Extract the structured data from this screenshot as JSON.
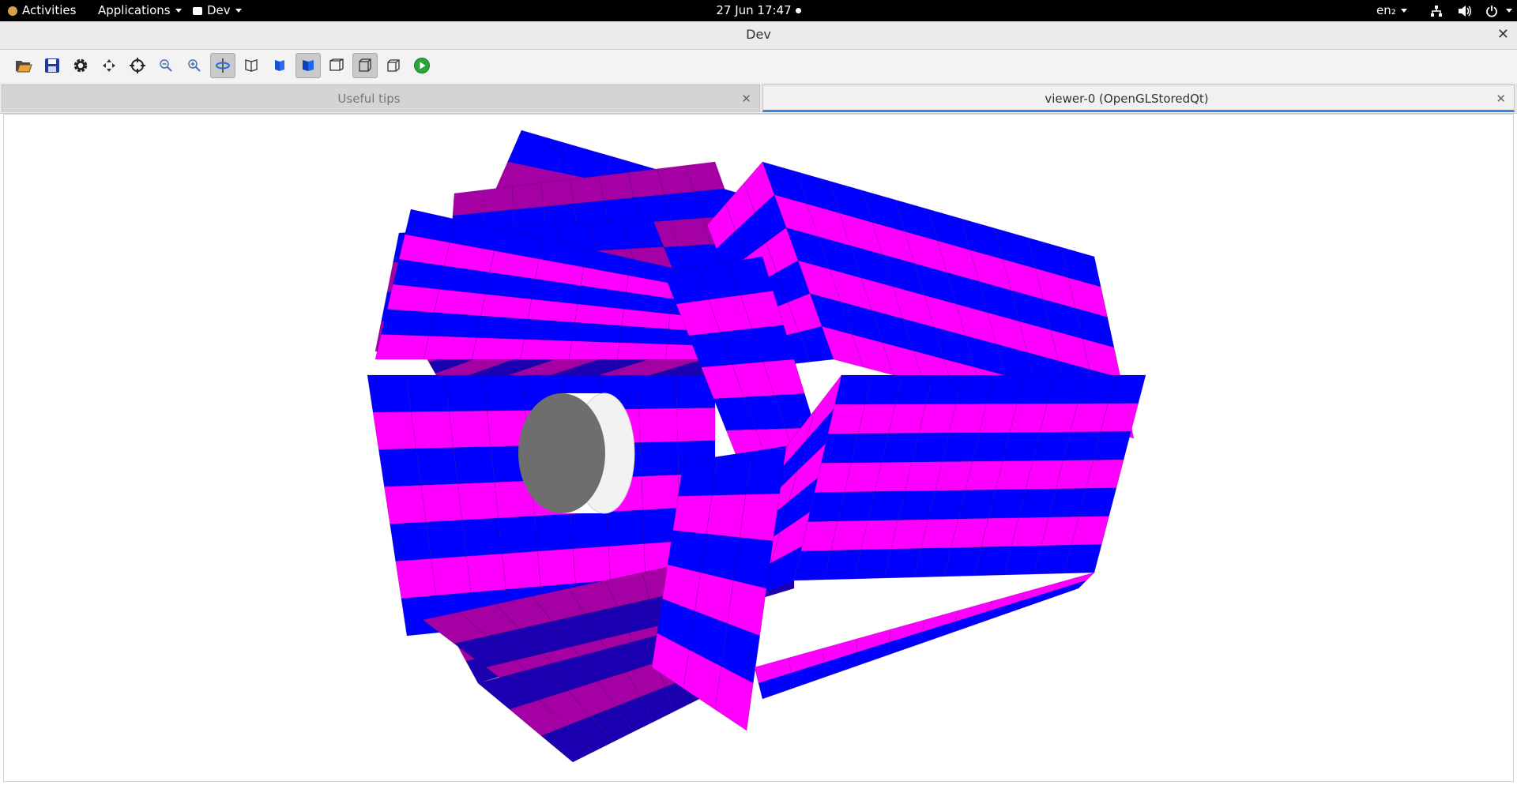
{
  "topbar": {
    "activities": "Activities",
    "applications": "Applications",
    "app_menu": "Dev",
    "clock": "27 Jun  17:47",
    "language": "en₂"
  },
  "window": {
    "title": "Dev",
    "close_glyph": "✕"
  },
  "toolbar": {
    "buttons": [
      {
        "icon": "open-folder-icon",
        "pressed": false
      },
      {
        "icon": "save-icon",
        "pressed": false
      },
      {
        "icon": "gear-icon",
        "pressed": false
      },
      {
        "icon": "move-icon",
        "pressed": false
      },
      {
        "icon": "pick-crosshair-icon",
        "pressed": false
      },
      {
        "icon": "zoom-out-icon",
        "pressed": false
      },
      {
        "icon": "zoom-in-icon",
        "pressed": false
      },
      {
        "icon": "rotate-icon",
        "pressed": true
      },
      {
        "icon": "wireframe-icon",
        "pressed": false
      },
      {
        "icon": "hidden-line-icon",
        "pressed": false
      },
      {
        "icon": "solid-surface-icon",
        "pressed": true
      },
      {
        "icon": "perspective-icon",
        "pressed": false
      },
      {
        "icon": "orthographic-icon",
        "pressed": true
      },
      {
        "icon": "reset-view-icon",
        "pressed": false
      },
      {
        "icon": "run-icon",
        "pressed": false
      }
    ]
  },
  "tabs": [
    {
      "label": "Useful tips",
      "close": "✕",
      "active": false
    },
    {
      "label": "viewer-0 (OpenGLStoredQt)",
      "close": "✕",
      "active": true
    }
  ],
  "scene": {
    "colors": {
      "magenta": "#ff00ff",
      "blue": "#0000ff",
      "purple": "#a400a4",
      "navy": "#1a00b0",
      "cylinder": "#6e6e6e"
    }
  }
}
